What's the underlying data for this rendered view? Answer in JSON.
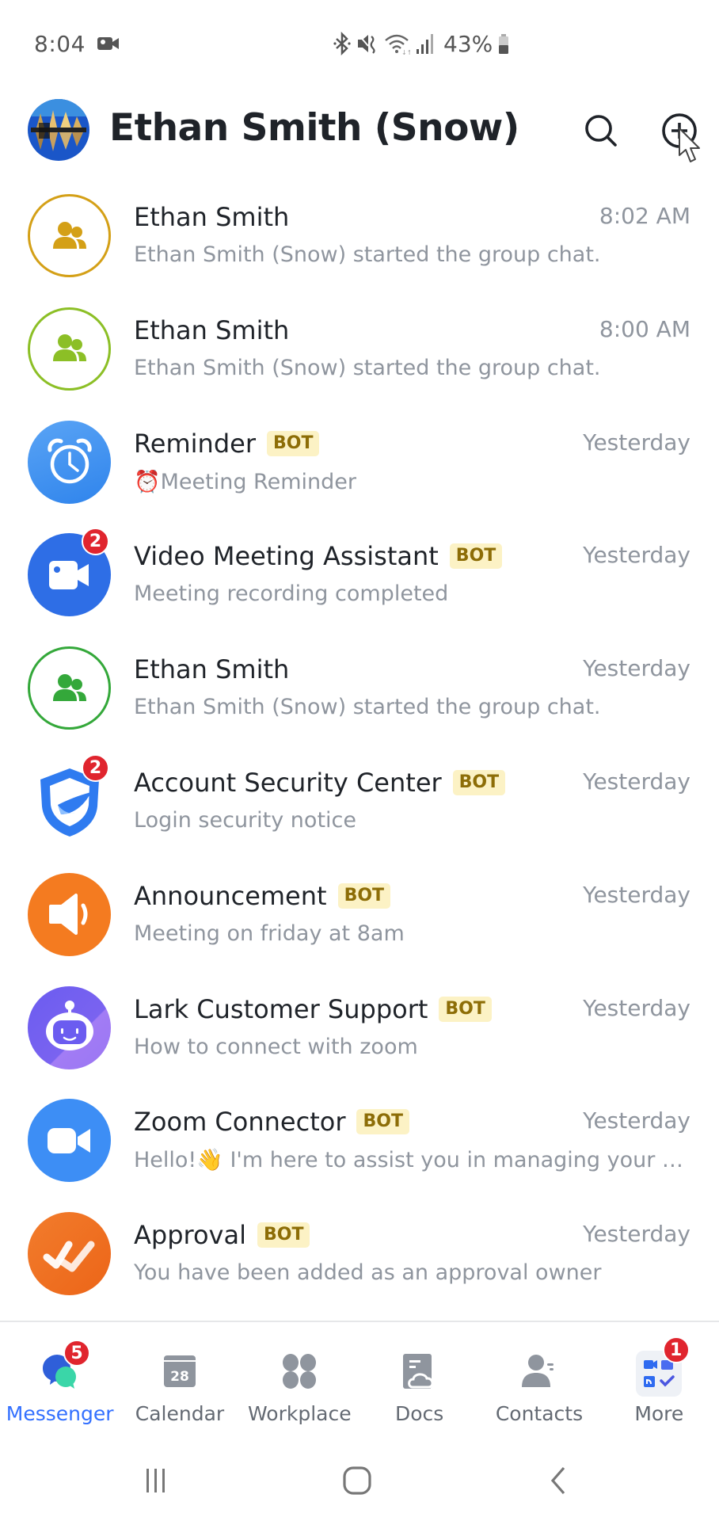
{
  "status_bar": {
    "time": "8:04",
    "battery_percent": "43%",
    "icons": [
      "video-recording-icon",
      "bluetooth-icon",
      "mute-icon",
      "wifi-icon",
      "signal-icon",
      "battery-icon"
    ]
  },
  "header": {
    "title": "Ethan Smith (Snow)",
    "search_icon": "search-icon",
    "add_icon": "plus-circle-icon"
  },
  "bot_label": "BOT",
  "chats": [
    {
      "name": "Ethan Smith",
      "bot": false,
      "time": "8:02 AM",
      "preview": "Ethan Smith (Snow) started the group chat.",
      "avatar": "group-icon",
      "color": "#d4a017",
      "unread": null
    },
    {
      "name": "Ethan Smith",
      "bot": false,
      "time": "8:00 AM",
      "preview": "Ethan Smith (Snow) started the group chat.",
      "avatar": "group-icon",
      "color": "#8cbf26",
      "unread": null
    },
    {
      "name": "Reminder",
      "bot": true,
      "time": "Yesterday",
      "preview": "⏰Meeting Reminder",
      "avatar": "alarm-clock-icon",
      "color": "#3e8ef0",
      "unread": null
    },
    {
      "name": "Video Meeting Assistant",
      "bot": true,
      "time": "Yesterday",
      "preview": "Meeting recording completed",
      "avatar": "video-camera-icon",
      "color": "#2e6ee6",
      "unread": "2"
    },
    {
      "name": "Ethan Smith",
      "bot": false,
      "time": "Yesterday",
      "preview": "Ethan Smith (Snow) started the group chat.",
      "avatar": "group-icon",
      "color": "#34a83a",
      "unread": null
    },
    {
      "name": "Account Security Center",
      "bot": true,
      "time": "Yesterday",
      "preview": "Login security notice",
      "avatar": "shield-icon",
      "color": "#2f7bf0",
      "unread": "2"
    },
    {
      "name": "Announcement",
      "bot": true,
      "time": "Yesterday",
      "preview": "Meeting on friday at 8am",
      "avatar": "speaker-icon",
      "color": "#f47b20",
      "unread": null
    },
    {
      "name": "Lark Customer Support",
      "bot": true,
      "time": "Yesterday",
      "preview": "How to connect with zoom",
      "avatar": "robot-icon",
      "color": "#7a63f0",
      "unread": null
    },
    {
      "name": "Zoom Connector",
      "bot": true,
      "time": "Yesterday",
      "preview": "Hello!👋 I'm here to assist you in managing your Zo...",
      "avatar": "zoom-camera-icon",
      "color": "#3d8ef5",
      "unread": null
    },
    {
      "name": "Approval",
      "bot": true,
      "time": "Yesterday",
      "preview": "You have been added as an approval owner",
      "avatar": "approval-check-icon",
      "color": "#f07424",
      "unread": null
    }
  ],
  "tabs": [
    {
      "label": "Messenger",
      "icon": "messenger-icon",
      "active": true,
      "badge": "5"
    },
    {
      "label": "Calendar",
      "icon": "calendar-icon",
      "active": false,
      "badge": null,
      "calendar_day": "28"
    },
    {
      "label": "Workplace",
      "icon": "workplace-icon",
      "active": false,
      "badge": null
    },
    {
      "label": "Docs",
      "icon": "docs-icon",
      "active": false,
      "badge": null
    },
    {
      "label": "Contacts",
      "icon": "contacts-icon",
      "active": false,
      "badge": null
    },
    {
      "label": "More",
      "icon": "more-apps-icon",
      "active": false,
      "badge": "1"
    }
  ],
  "colors": {
    "accent": "#3370ff",
    "badge_red": "#e0252e",
    "bot_badge_bg": "#fcf2c5",
    "bot_badge_text": "#8d6d07",
    "secondary_text": "#8f959e"
  }
}
